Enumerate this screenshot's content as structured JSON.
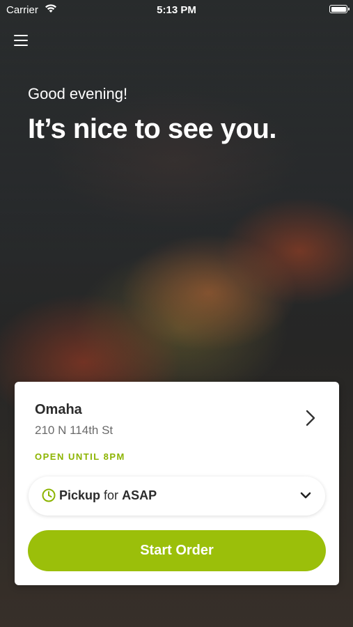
{
  "status_bar": {
    "carrier": "Carrier",
    "time": "5:13 PM"
  },
  "header": {
    "greeting": "Good evening!",
    "headline": "It’s nice to see you."
  },
  "location": {
    "name": "Omaha",
    "address": "210 N 114th St",
    "hours": "OPEN UNTIL 8PM"
  },
  "order_type": {
    "mode": "Pickup",
    "connector": "for",
    "time": "ASAP"
  },
  "actions": {
    "start_order": "Start Order"
  },
  "colors": {
    "accent": "#9bbf0a",
    "hours_text": "#8cb400"
  },
  "icons": [
    "menu-icon",
    "wifi-icon",
    "battery-icon",
    "chevron-right-icon",
    "clock-icon",
    "chevron-down-icon"
  ]
}
